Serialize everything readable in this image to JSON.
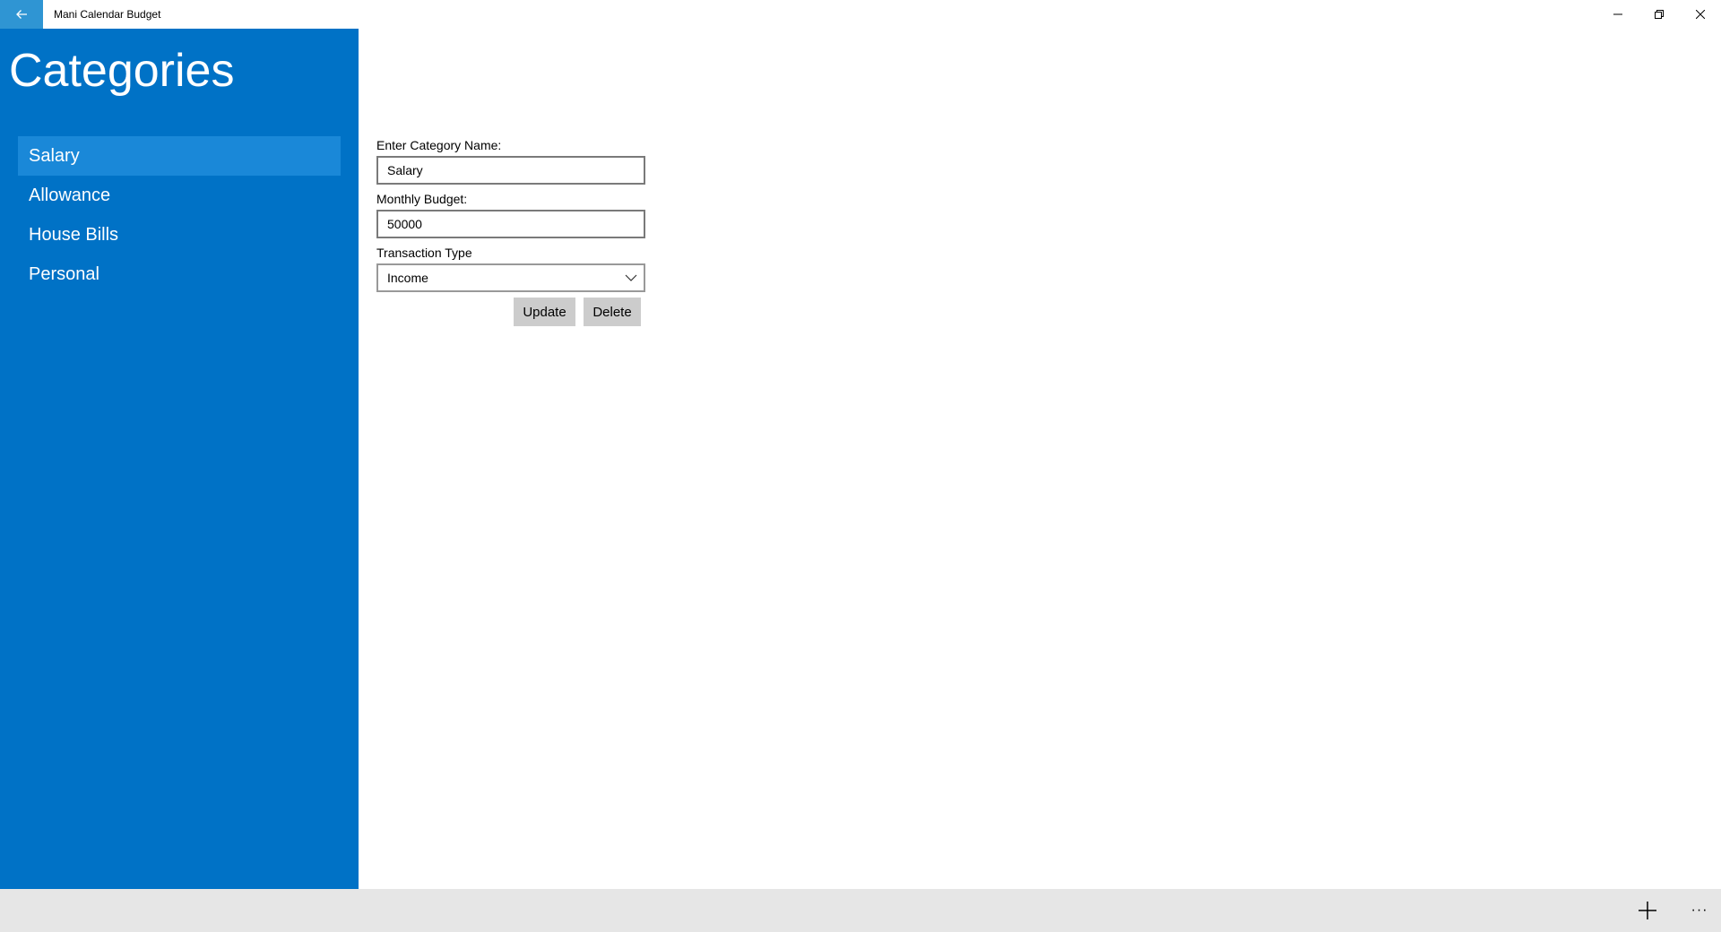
{
  "window": {
    "title": "Mani Calendar Budget",
    "back_icon": "back-arrow-icon",
    "controls": [
      "minimize-icon",
      "restore-icon",
      "close-icon"
    ]
  },
  "sidebar": {
    "title": "Categories",
    "items": [
      {
        "label": "Salary",
        "selected": true
      },
      {
        "label": "Allowance",
        "selected": false
      },
      {
        "label": "House Bills",
        "selected": false
      },
      {
        "label": "Personal",
        "selected": false
      }
    ]
  },
  "form": {
    "name_label": "Enter Category Name:",
    "name_value": "Salary",
    "budget_label": "Monthly Budget:",
    "budget_value": "50000",
    "type_label": "Transaction Type",
    "type_value": "Income",
    "update_label": "Update",
    "delete_label": "Delete"
  },
  "appbar": {
    "add_icon": "plus-icon",
    "more_icon": "more-icon",
    "more_glyph": "···"
  },
  "colors": {
    "sidebar_bg": "#0072c6",
    "selected_item_bg": "#1a88d8",
    "back_button_bg": "#2f95d3",
    "appbar_bg": "#e6e6e6",
    "button_bg": "#cccccc"
  }
}
